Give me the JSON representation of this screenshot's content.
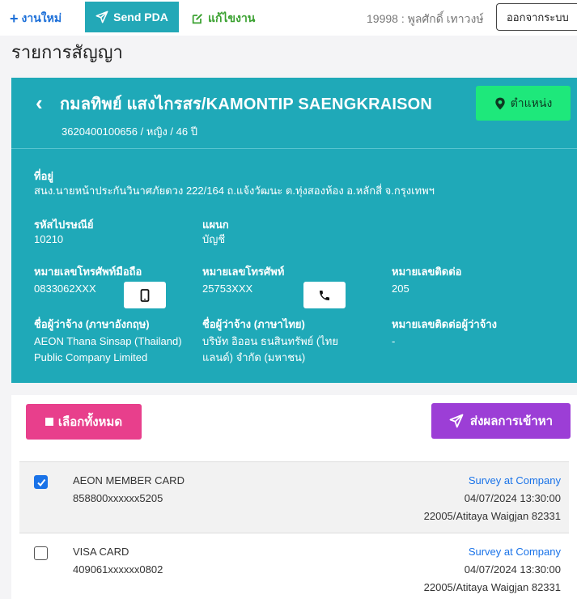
{
  "topbar": {
    "new_job": "งานใหม่",
    "send_pda": "Send PDA",
    "edit_job": "แก้ไขงาน",
    "user": "19998 : พูลศักดิ์ เทาวงษ์",
    "logout": "ออกจากระบบ"
  },
  "page_title": "รายการสัญญา",
  "customer": {
    "name": "กมลทิพย์ แสงไกรสร/KAMONTIP SAENGKRAISON",
    "sub": "3620400100656 / หญิง / 46 ปี",
    "location_button": "ตำแหน่ง",
    "address_label": "ที่อยู่",
    "address": "สนง.นายหน้าประกันวินาศภัยดวง 222/164 ถ.แจ้งวัฒนะ ต.ทุ่งสองห้อง อ.หลักสี่ จ.กรุงเทพฯ",
    "postcode_label": "รหัสไปรษณีย์",
    "postcode": "10210",
    "department_label": "แผนก",
    "department": "บัญชี",
    "mobile_label": "หมายเลขโทรศัพท์มือถือ",
    "mobile": "0833062XXX",
    "phone_label": "หมายเลขโทรศัพท์",
    "phone": "25753XXX",
    "ext_label": "หมายเลขติดต่อ",
    "ext": "205",
    "employer_en_label": "ชื่อผู้ว่าจ้าง (ภาษาอังกฤษ)",
    "employer_en_1": "AEON Thana Sinsap (Thailand)",
    "employer_en_2": "Public Company Limited",
    "employer_th_label": "ชื่อผู้ว่าจ้าง (ภาษาไทย)",
    "employer_th_1": "บริษัท อิออน ธนสินทรัพย์ (ไทย",
    "employer_th_2": "แลนด์) จำกัด (มหาชน)",
    "employer_contact_label": "หมายเลขติดต่อผู้ว่าจ้าง",
    "employer_contact": "-"
  },
  "actions": {
    "select_all": "เลือกทั้งหมด",
    "send_result": "ส่งผลการเข้าหา"
  },
  "contracts": [
    {
      "checked": true,
      "card": "AEON MEMBER CARD",
      "number": "858800xxxxxx5205",
      "type": "Survey at Company",
      "date": "04/07/2024 13:30:00",
      "agent": "22005/Atitaya Waigjan 82331"
    },
    {
      "checked": false,
      "card": "VISA CARD",
      "number": "409061xxxxxx0802",
      "type": "Survey at Company",
      "date": "04/07/2024 13:30:00",
      "agent": "22005/Atitaya Waigjan 82331"
    }
  ],
  "colors": {
    "teal": "#1fa9b8",
    "location_green": "#1ee87b",
    "select_pink": "#e83f8c",
    "send_purple": "#9c3ed6",
    "link_blue": "#1a73e8"
  }
}
